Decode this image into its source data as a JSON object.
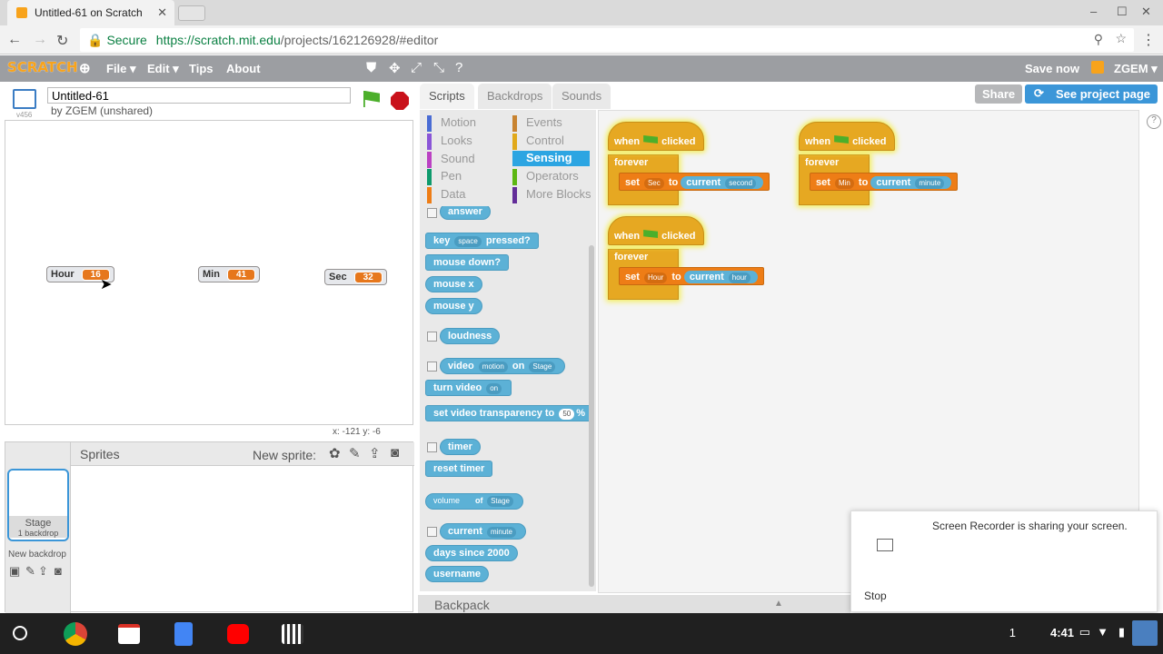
{
  "browser": {
    "tab_title": "Untitled-61 on Scratch",
    "secure_label": "Secure",
    "url_host": "https://scratch.mit.edu",
    "url_path": "/projects/162126928/#editor",
    "window_controls": [
      "–",
      "☐",
      "✕"
    ]
  },
  "menubar": {
    "logo": "SCRATCH",
    "items": [
      "File ▾",
      "Edit ▾",
      "Tips",
      "About"
    ],
    "save_now": "Save now",
    "user": "ZGEM ▾"
  },
  "stage": {
    "project_title": "Untitled-61",
    "byline": "by ZGEM (unshared)",
    "version": "v456",
    "monitors": [
      {
        "label": "Hour",
        "value": "16"
      },
      {
        "label": "Min",
        "value": "41"
      },
      {
        "label": "Sec",
        "value": "32"
      }
    ],
    "coords": "x: -121  y: -6"
  },
  "sprites": {
    "title": "Sprites",
    "new_sprite": "New sprite:",
    "stage_label": "Stage",
    "stage_sub": "1 backdrop",
    "new_backdrop": "New backdrop"
  },
  "palette": {
    "tabs": [
      "Scripts",
      "Backdrops",
      "Sounds"
    ],
    "categories_left": [
      {
        "name": "Motion",
        "color": "#4a6cd4"
      },
      {
        "name": "Looks",
        "color": "#8a55d7"
      },
      {
        "name": "Sound",
        "color": "#bb42c3"
      },
      {
        "name": "Pen",
        "color": "#0e9a6c"
      },
      {
        "name": "Data",
        "color": "#ee7d16"
      }
    ],
    "categories_right": [
      {
        "name": "Events",
        "color": "#c88330"
      },
      {
        "name": "Control",
        "color": "#e1a91a"
      },
      {
        "name": "Sensing",
        "color": "#2ca5e2"
      },
      {
        "name": "Operators",
        "color": "#5cb712"
      },
      {
        "name": "More Blocks",
        "color": "#632d99"
      }
    ],
    "blocks": {
      "answer": "answer",
      "key": "key",
      "key_opt": "space",
      "pressed": "pressed?",
      "mouse_down": "mouse down?",
      "mouse_x": "mouse x",
      "mouse_y": "mouse y",
      "loudness": "loudness",
      "video": "video",
      "video_opt": "motion",
      "on": "on",
      "video_target": "Stage",
      "turn_video": "turn video",
      "turn_opt": "on",
      "set_transp": "set video transparency to",
      "transp_val": "50",
      "pct": "%",
      "timer": "timer",
      "reset_timer": "reset timer",
      "volume": "volume",
      "of": "of",
      "of_target": "Stage",
      "current": "current",
      "current_opt": "minute",
      "days_since": "days since 2000",
      "username": "username"
    }
  },
  "scripts": {
    "when": "when",
    "clicked": "clicked",
    "forever": "forever",
    "set": "set",
    "to": "to",
    "current": "current",
    "s1_var": "Sec",
    "s1_opt": "second",
    "s2_var": "Min",
    "s2_opt": "minute",
    "s3_var": "Hour",
    "s3_opt": "hour"
  },
  "header_buttons": {
    "share": "Share",
    "see_project": "See project page"
  },
  "backpack": "Backpack",
  "notification": {
    "message": "Screen Recorder is sharing your screen.",
    "stop": "Stop"
  },
  "taskbar": {
    "badge": "1",
    "time": "4:41"
  }
}
